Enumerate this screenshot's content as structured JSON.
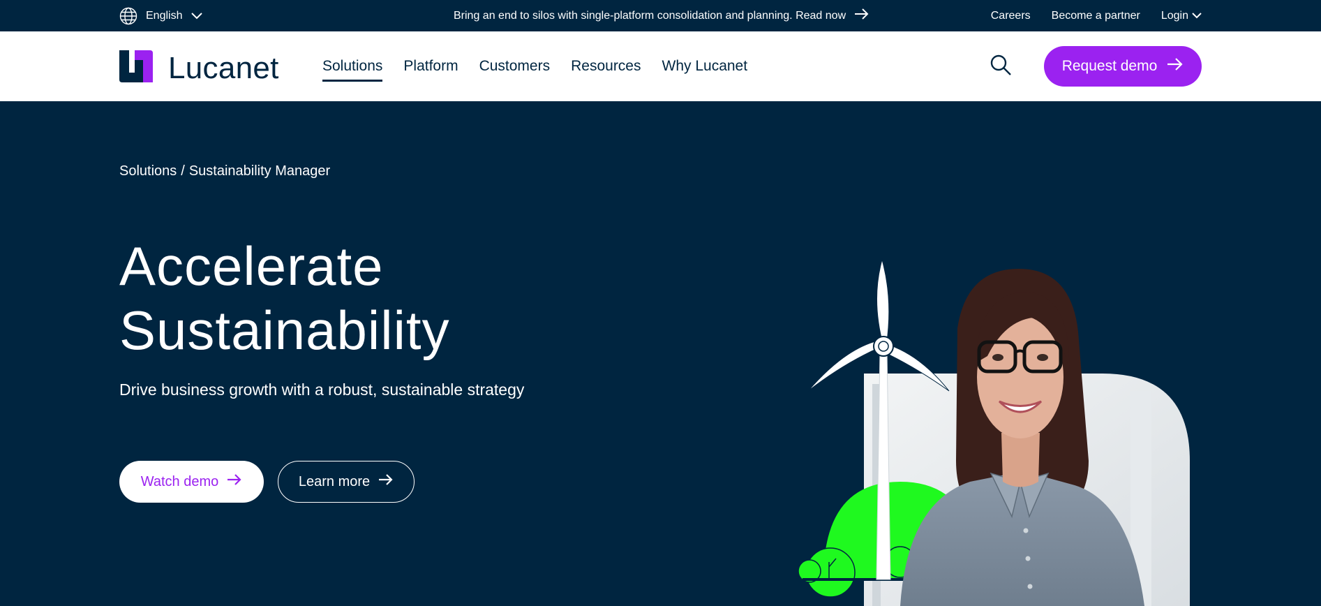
{
  "topbar": {
    "language": "English",
    "announcement": "Bring an end to silos with single-platform consolidation and planning. Read now",
    "links": [
      "Careers",
      "Become a partner",
      "Login"
    ]
  },
  "nav": {
    "brand": "Lucanet",
    "menu": [
      "Solutions",
      "Platform",
      "Customers",
      "Resources",
      "Why Lucanet"
    ],
    "active": "Solutions",
    "cta": "Request demo"
  },
  "hero": {
    "breadcrumb": [
      "Solutions",
      "/",
      "Sustainability Manager"
    ],
    "title_line1": "Accelerate",
    "title_line2": "Sustainability",
    "subtitle": "Drive business growth with a robust, sustainable strategy",
    "primary_button": "Watch demo",
    "secondary_button": "Learn more"
  },
  "colors": {
    "navy": "#002540",
    "purple": "#9b22f0",
    "green": "#1ff91f",
    "white": "#ffffff"
  },
  "icons": [
    "globe-icon",
    "chevron-down-icon",
    "arrow-right-icon",
    "search-icon"
  ]
}
